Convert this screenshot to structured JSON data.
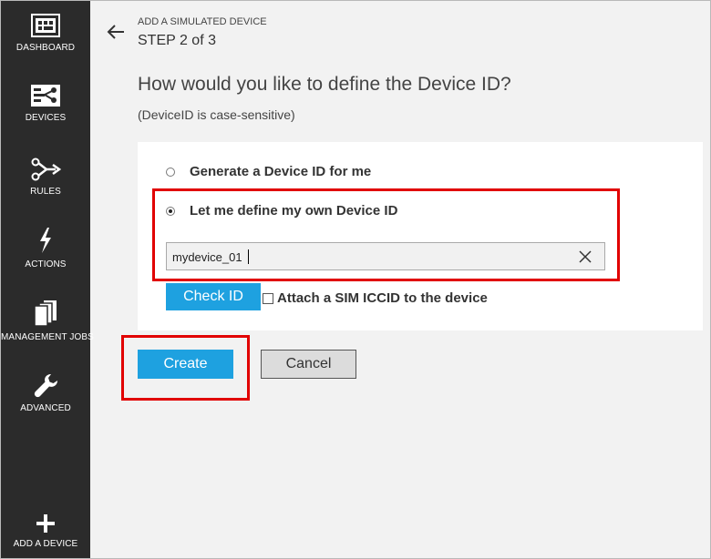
{
  "sidebar": {
    "items": [
      {
        "label": "DASHBOARD",
        "icon": "dashboard-icon"
      },
      {
        "label": "DEVICES",
        "icon": "devices-icon"
      },
      {
        "label": "RULES",
        "icon": "rules-icon"
      },
      {
        "label": "ACTIONS",
        "icon": "lightning-icon"
      },
      {
        "label": "MANAGEMENT JOBS",
        "icon": "documents-icon"
      },
      {
        "label": "ADVANCED",
        "icon": "wrench-icon"
      },
      {
        "label": "ADD A DEVICE",
        "icon": "plus-icon"
      }
    ]
  },
  "header": {
    "caption": "ADD A SIMULATED DEVICE",
    "step": "STEP 2 of 3"
  },
  "main": {
    "question": "How would you like to define the Device ID?",
    "note": "(DeviceID is case-sensitive)",
    "options": [
      {
        "label": "Generate a Device ID for me",
        "selected": false
      },
      {
        "label": "Let me define my own Device ID",
        "selected": true
      }
    ],
    "device_id": {
      "value": "mydevice_01",
      "placeholder": ""
    },
    "check_id_label": "Check ID",
    "sim_checkbox_label": "Attach a SIM ICCID to the device",
    "sim_checkbox_checked": false
  },
  "actions": {
    "create_label": "Create",
    "cancel_label": "Cancel"
  },
  "colors": {
    "sidebar_bg": "#2b2b2b",
    "accent": "#1ea1e0",
    "highlight": "#e10000"
  }
}
